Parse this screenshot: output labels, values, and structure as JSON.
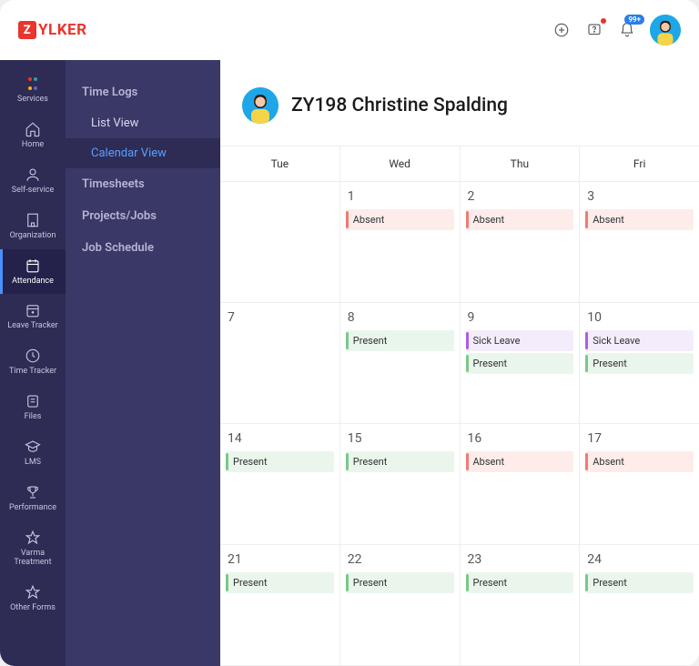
{
  "logo": {
    "badge": "Z",
    "text": "YLKER"
  },
  "topbar": {
    "notif_badge": "99+"
  },
  "nav": {
    "items": [
      {
        "label": "Services"
      },
      {
        "label": "Home"
      },
      {
        "label": "Self-service"
      },
      {
        "label": "Organization"
      },
      {
        "label": "Attendance"
      },
      {
        "label": "Leave Tracker"
      },
      {
        "label": "Time Tracker"
      },
      {
        "label": "Files"
      },
      {
        "label": "LMS"
      },
      {
        "label": "Performance"
      },
      {
        "label": "Varma Treatment"
      },
      {
        "label": "Other Forms"
      }
    ]
  },
  "subnav": {
    "group1": "Time Logs",
    "item_list": "List View",
    "item_calendar": "Calendar View",
    "group2": "Timesheets",
    "group3": "Projects/Jobs",
    "group4": "Job Schedule"
  },
  "user": {
    "name": "ZY198 Christine Spalding"
  },
  "calendar": {
    "days": [
      "Tue",
      "Wed",
      "Thu",
      "Fri"
    ],
    "rows": [
      {
        "cells": [
          {
            "date": "",
            "entries": []
          },
          {
            "date": "1",
            "entries": [
              {
                "label": "Absent",
                "type": "absent"
              }
            ]
          },
          {
            "date": "2",
            "entries": [
              {
                "label": "Absent",
                "type": "absent"
              }
            ]
          },
          {
            "date": "3",
            "entries": [
              {
                "label": "Absent",
                "type": "absent"
              }
            ]
          }
        ]
      },
      {
        "cells": [
          {
            "date": "7",
            "entries": []
          },
          {
            "date": "8",
            "entries": [
              {
                "label": "Present",
                "type": "present"
              }
            ]
          },
          {
            "date": "9",
            "entries": [
              {
                "label": "Sick Leave",
                "type": "sick"
              },
              {
                "label": "Present",
                "type": "present"
              }
            ]
          },
          {
            "date": "10",
            "entries": [
              {
                "label": "Sick Leave",
                "type": "sick"
              },
              {
                "label": "Present",
                "type": "present"
              }
            ]
          }
        ]
      },
      {
        "cells": [
          {
            "date": "14",
            "entries": [
              {
                "label": "Present",
                "type": "present"
              }
            ]
          },
          {
            "date": "15",
            "entries": [
              {
                "label": "Present",
                "type": "present"
              }
            ]
          },
          {
            "date": "16",
            "entries": [
              {
                "label": "Absent",
                "type": "absent"
              }
            ]
          },
          {
            "date": "17",
            "entries": [
              {
                "label": "Absent",
                "type": "absent"
              }
            ]
          }
        ]
      },
      {
        "cells": [
          {
            "date": "21",
            "entries": [
              {
                "label": "Present",
                "type": "present"
              }
            ]
          },
          {
            "date": "22",
            "entries": [
              {
                "label": "Present",
                "type": "present"
              }
            ]
          },
          {
            "date": "23",
            "entries": [
              {
                "label": "Present",
                "type": "present"
              }
            ]
          },
          {
            "date": "24",
            "entries": [
              {
                "label": "Present",
                "type": "present"
              }
            ]
          }
        ]
      }
    ]
  }
}
